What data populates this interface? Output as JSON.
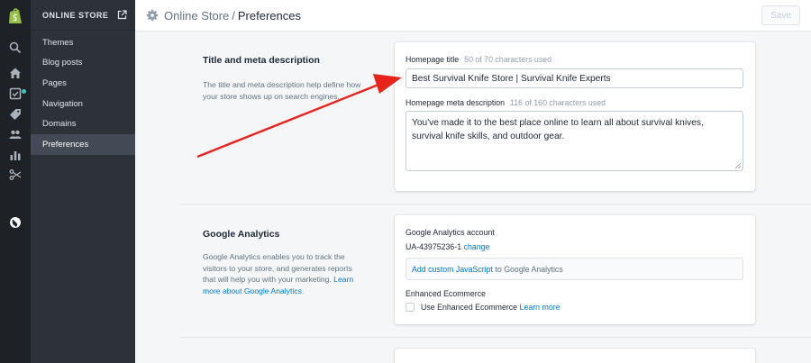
{
  "app": {
    "section": "ONLINE STORE",
    "accent": "#007ace"
  },
  "rail": {
    "icons": [
      "shopify-logo",
      "search-icon",
      "home-icon",
      "orders-icon",
      "tag-icon",
      "customers-icon",
      "reports-icon",
      "discounts-icon",
      "globe-icon"
    ]
  },
  "sidebar": {
    "items": [
      {
        "label": "Themes"
      },
      {
        "label": "Blog posts"
      },
      {
        "label": "Pages"
      },
      {
        "label": "Navigation"
      },
      {
        "label": "Domains"
      },
      {
        "label": "Preferences",
        "active": true
      }
    ]
  },
  "topbar": {
    "breadcrumb": "Online Store",
    "separator": "/",
    "current": "Preferences",
    "save_label": "Save"
  },
  "meta": {
    "title": "Title and meta description",
    "description": "The title and meta description help define how your store shows up on search engines.",
    "homepage_title_label": "Homepage title",
    "homepage_title_hint": "50 of 70 characters used",
    "homepage_title_value": "Best Survival Knife Store | Survival Knife Experts",
    "meta_desc_label": "Homepage meta description",
    "meta_desc_hint": "116 of 160 characters used",
    "meta_desc_value": "You've made it to the best place online to learn all about survival knives, survival knife skills, and outdoor gear."
  },
  "analytics": {
    "title": "Google Analytics",
    "description": "Google Analytics enables you to track the visitors to your store, and generates reports that will help you with your marketing.",
    "learn_more": "Learn more about Google Analytics",
    "period": ".",
    "account_label": "Google Analytics account",
    "account_id": "UA-43975236-1",
    "change_link": "change",
    "add_js_link": "Add custom JavaScript",
    "add_js_suffix": "to Google Analytics",
    "ecommerce_label": "Enhanced Ecommerce",
    "ecommerce_checkbox": "Use Enhanced Ecommerce",
    "ecommerce_learn_more": "Learn more"
  },
  "annotation": {
    "arrow_color": "#e8231b"
  }
}
